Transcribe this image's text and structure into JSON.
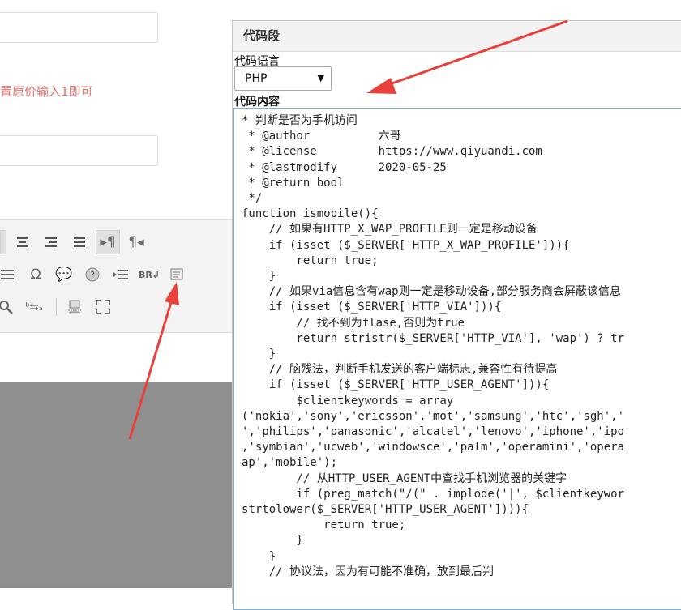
{
  "form": {
    "hint_text": "置原价输入1即可"
  },
  "toolbar": {
    "row1": [
      "align-left-icon",
      "align-center-icon",
      "align-right-icon",
      "align-justify-icon",
      "ltr-icon",
      "rtl-icon"
    ],
    "row2": [
      "horizontal-rule-icon",
      "special-char-icon",
      "emoticon-icon",
      "help-icon",
      "indent-icon",
      "line-break-icon",
      "code-snippet-icon"
    ],
    "row3": [
      "find-icon",
      "replace-icon",
      "page-break-icon",
      "fullscreen-icon"
    ]
  },
  "dialog": {
    "title": "代码段",
    "language_label": "代码语言",
    "language_value": "PHP",
    "content_label": "代码内容",
    "code_lines": [
      "* 判断是否为手机访问",
      " * @author          六哥",
      " * @license         https://www.qiyuandi.com",
      " * @lastmodify      2020-05-25",
      " * @return bool",
      " */",
      "function ismobile(){",
      "    // 如果有HTTP_X_WAP_PROFILE则一定是移动设备",
      "    if (isset ($_SERVER['HTTP_X_WAP_PROFILE'])){",
      "        return true;",
      "    }",
      "    // 如果via信息含有wap则一定是移动设备,部分服务商会屏蔽该信息",
      "    if (isset ($_SERVER['HTTP_VIA'])){",
      "        // 找不到为flase,否则为true",
      "        return stristr($_SERVER['HTTP_VIA'], 'wap') ? tr",
      "    }",
      "    // 脑残法，判断手机发送的客户端标志,兼容性有待提高",
      "    if (isset ($_SERVER['HTTP_USER_AGENT'])){",
      "        $clientkeywords = array",
      "('nokia','sony','ericsson','mot','samsung','htc','sgh','",
      "','philips','panasonic','alcatel','lenovo','iphone','ipo",
      ",'symbian','ucweb','windowsce','palm','operamini','opera",
      "ap','mobile');",
      "        // 从HTTP_USER_AGENT中查找手机浏览器的关键字",
      "        if (preg_match(\"/(\" . implode('|', $clientkeywor",
      "strtolower($_SERVER['HTTP_USER_AGENT']))){",
      "            return true;",
      "        }",
      "    }",
      "    // 协议法，因为有可能不准确，放到最后判"
    ]
  },
  "colors": {
    "annotation_arrow": "#e8403a",
    "hint": "#e8746f",
    "code_border": "#7ab1d9"
  }
}
